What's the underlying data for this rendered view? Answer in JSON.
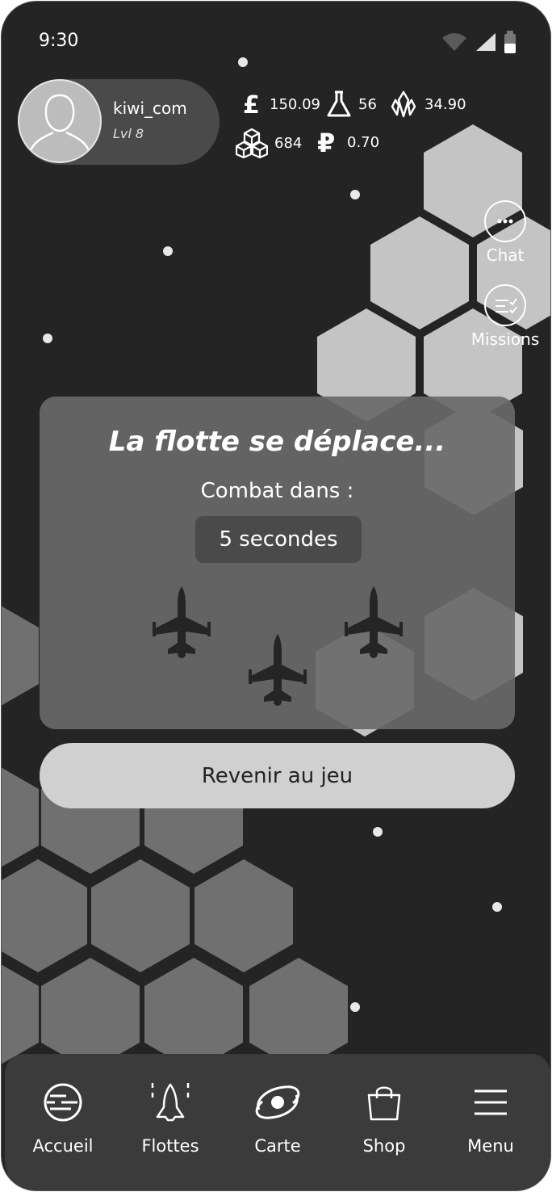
{
  "status": {
    "time": "9:30"
  },
  "profile": {
    "username": "kiwi_com",
    "level": "Lvl 8"
  },
  "resources": [
    {
      "icon": "pound-icon",
      "value": "150.09"
    },
    {
      "icon": "flask-icon",
      "value": "56"
    },
    {
      "icon": "crystal-icon",
      "value": "34.90"
    },
    {
      "icon": "cubes-icon",
      "value": "684"
    },
    {
      "icon": "ruble-icon",
      "value": "0.70"
    }
  ],
  "side": {
    "chat_label": "Chat",
    "missions_label": "Missions"
  },
  "modal": {
    "title": "La flotte se déplace...",
    "subtitle": "Combat dans :",
    "timer": "5 secondes"
  },
  "return_label": "Revenir au jeu",
  "nav": [
    {
      "icon": "planet-icon",
      "label": "Accueil"
    },
    {
      "icon": "rocket-icon",
      "label": "Flottes"
    },
    {
      "icon": "galaxy-icon",
      "label": "Carte"
    },
    {
      "icon": "bag-icon",
      "label": "Shop"
    },
    {
      "icon": "menu-icon",
      "label": "Menu"
    }
  ],
  "colors": {
    "background": "#242424",
    "hex_light": "#c4c4c4",
    "hex_dark": "#707070",
    "panel": "#3b3b3b"
  }
}
